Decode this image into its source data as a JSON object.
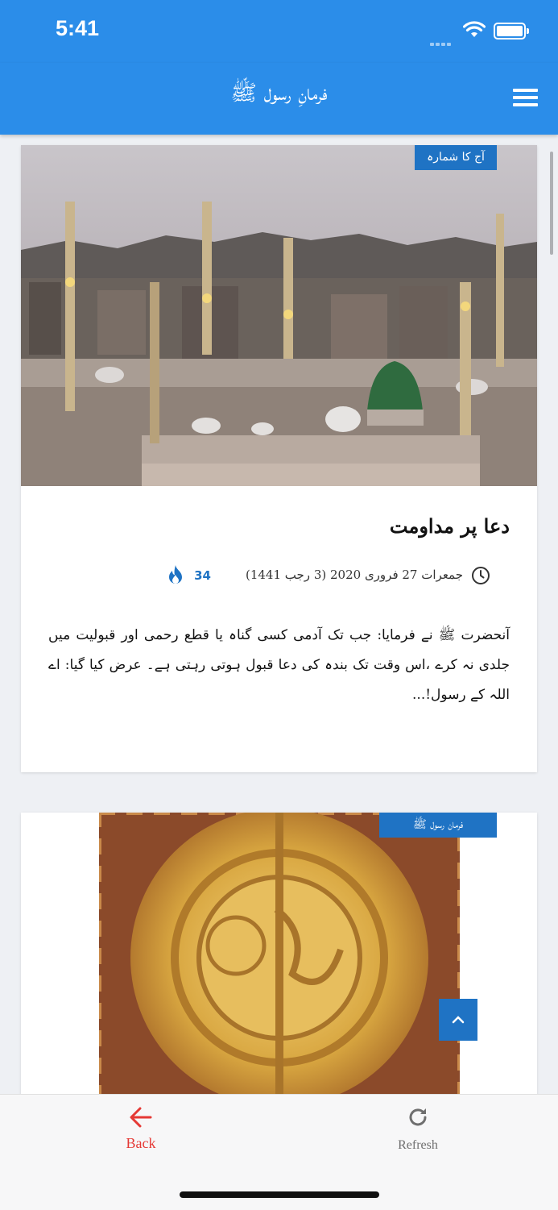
{
  "status": {
    "time": "5:41"
  },
  "header": {
    "title": "فرمانِ رسول ﷺ"
  },
  "cards": [
    {
      "badge": "آج کا شمارہ",
      "title": "دعا پر مداومت",
      "date": "جمعرات 27 فروری 2020 (3 رجب 1441)",
      "views": "34",
      "excerpt": "آنحضرت ﷺ نے فرمایا: جب تک آدمی کسی گناہ یا قطع رحمی اور قبولیت میں جلدی نہ کرے ،اس وقت تک بندہ کی دعا قبول ہوتی رہتی ہے۔ عرض کیا گیا: اے اللہ کے رسول!..."
    },
    {
      "badge": "فرمان رسول ﷺ"
    }
  ],
  "bottom_nav": {
    "back_label": "Back",
    "refresh_label": "Refresh"
  },
  "colors": {
    "primary": "#2b8de9",
    "badge": "#1f73c4",
    "back": "#e53935"
  },
  "icons": [
    "wifi-icon",
    "battery-icon",
    "menu-icon",
    "clock-icon",
    "fire-icon",
    "chevron-up-icon",
    "arrow-left-icon",
    "refresh-icon"
  ]
}
